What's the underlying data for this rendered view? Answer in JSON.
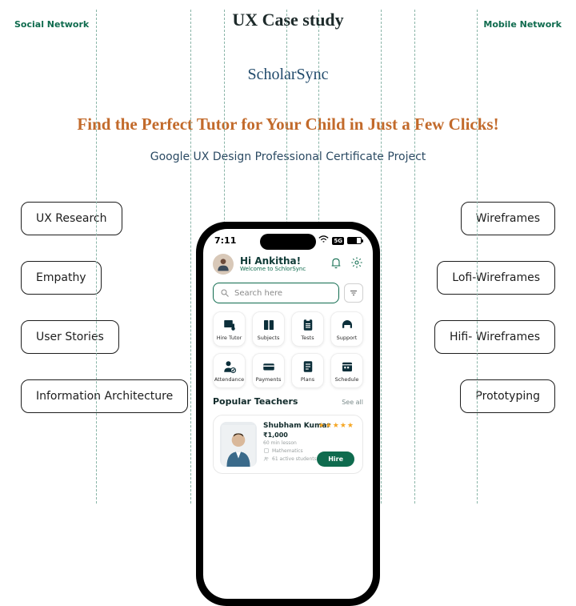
{
  "header": {
    "left_label": "Social Network",
    "right_label": "Mobile Network",
    "title": "UX Case study",
    "brand": "ScholarSync",
    "tagline": "Find the Perfect Tutor for Your Child in Just a Few Clicks!",
    "subtitle": "Google UX Design Professional Certificate Project"
  },
  "chips_left": [
    "UX Research",
    "Empathy",
    "User Stories",
    "Information Architecture"
  ],
  "chips_right": [
    "Wireframes",
    "Lofi-Wireframes",
    "Hifi- Wireframes",
    "Prototyping"
  ],
  "phone": {
    "time": "7:11",
    "greeting": "Hi Ankitha!",
    "greeting_sub": "Welcome to SchlorSync",
    "search_placeholder": "Search here",
    "tiles": [
      "Hire Tutor",
      "Subjects",
      "Tests",
      "Support",
      "Attendance",
      "Payments",
      "Plans",
      "Schedule"
    ],
    "section_title": "Popular Teachers",
    "see_all": "See all",
    "teacher": {
      "name": "Shubham Kumar",
      "price": "₹1,000",
      "lesson": "60 min lesson",
      "subject": "Mathematics",
      "students": "61 active students",
      "stars": "★★★★★",
      "hire_label": "Hire"
    }
  }
}
